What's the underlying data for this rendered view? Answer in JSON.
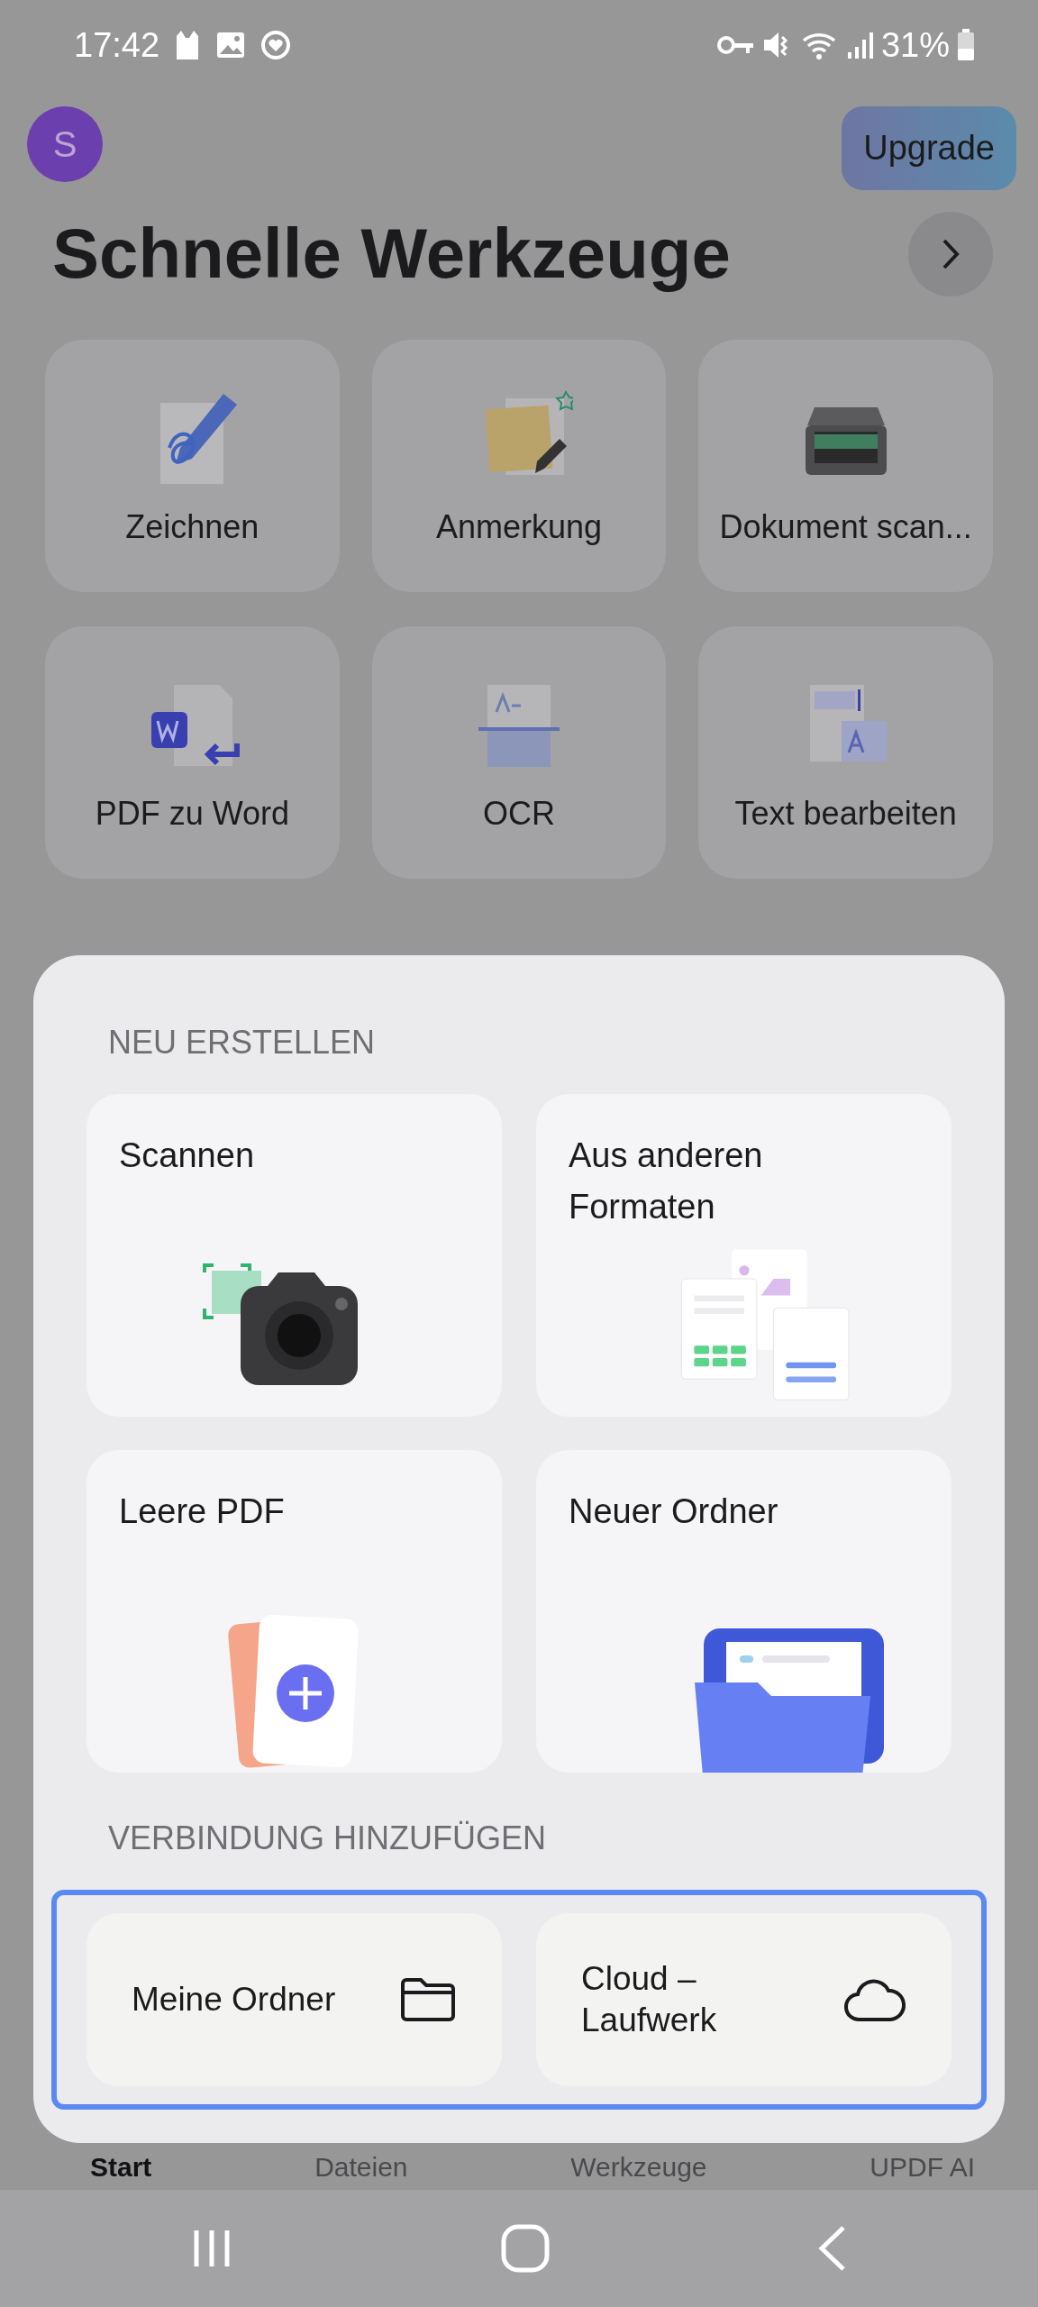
{
  "status_bar": {
    "time": "17:42",
    "battery": "31%"
  },
  "header": {
    "avatar": "S",
    "upgrade": "Upgrade"
  },
  "quick_tools": {
    "title": "Schnelle Werkzeuge",
    "items": [
      {
        "label": "Zeichnen",
        "kind": "draw"
      },
      {
        "label": "Anmerkung",
        "kind": "note"
      },
      {
        "label": "Dokument scan...",
        "kind": "scanner"
      },
      {
        "label": "PDF zu Word",
        "kind": "word"
      },
      {
        "label": "OCR",
        "kind": "ocr"
      },
      {
        "label": "Text bearbeiten",
        "kind": "text"
      }
    ]
  },
  "sheet": {
    "sections": [
      {
        "heading": "NEU ERSTELLEN",
        "highlighted": false,
        "items": [
          {
            "label": "Scannen",
            "kind": "camera"
          },
          {
            "label": "Aus anderen Formaten",
            "kind": "formats"
          },
          {
            "label": "Leere PDF",
            "kind": "blank"
          },
          {
            "label": "Neuer Ordner",
            "kind": "newfolder"
          }
        ]
      },
      {
        "heading": "VERBINDUNG HINZUFÜGEN",
        "highlighted": true,
        "items": [
          {
            "label": "Meine Ordner",
            "kind": "folder"
          },
          {
            "label": "Cloud – Laufwerk",
            "kind": "cloud"
          }
        ]
      }
    ]
  },
  "tab_bar": [
    {
      "label": "Start",
      "selected": true
    },
    {
      "label": "Dateien",
      "selected": false
    },
    {
      "label": "Werkzeuge",
      "selected": false
    },
    {
      "label": "UPDF AI",
      "selected": false
    }
  ]
}
